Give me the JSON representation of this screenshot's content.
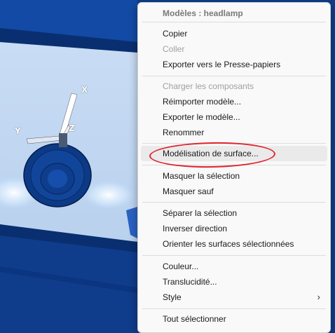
{
  "viewport": {
    "axis_x": "X",
    "axis_y": "Y",
    "axis_z": "Z"
  },
  "menu": {
    "header": "Modèles : headlamp",
    "items": [
      {
        "label": "Copier",
        "disabled": false
      },
      {
        "label": "Coller",
        "disabled": true
      },
      {
        "label": "Exporter vers le Presse-papiers",
        "disabled": false
      },
      {
        "label": "Charger les composants",
        "disabled": true
      },
      {
        "label": "Réimporter modèle...",
        "disabled": false
      },
      {
        "label": "Exporter le modèle...",
        "disabled": false
      },
      {
        "label": "Renommer",
        "disabled": false
      },
      {
        "label": "Modélisation de surface...",
        "disabled": false,
        "highlighted": true
      },
      {
        "label": "Masquer la sélection",
        "disabled": false
      },
      {
        "label": "Masquer sauf",
        "disabled": false
      },
      {
        "label": "Séparer la sélection",
        "disabled": false
      },
      {
        "label": "Inverser direction",
        "disabled": false
      },
      {
        "label": "Orienter les surfaces sélectionnées",
        "disabled": false
      },
      {
        "label": "Couleur...",
        "disabled": false
      },
      {
        "label": "Translucidité...",
        "disabled": false
      },
      {
        "label": "Style",
        "disabled": false,
        "submenu": true
      },
      {
        "label": "Tout sélectionner",
        "disabled": false
      }
    ],
    "submenu_glyph": "›"
  },
  "colors": {
    "model_blue": "#0f3d8c",
    "annotation_red": "#e0222c",
    "menu_bg": "#f9f9f9"
  }
}
